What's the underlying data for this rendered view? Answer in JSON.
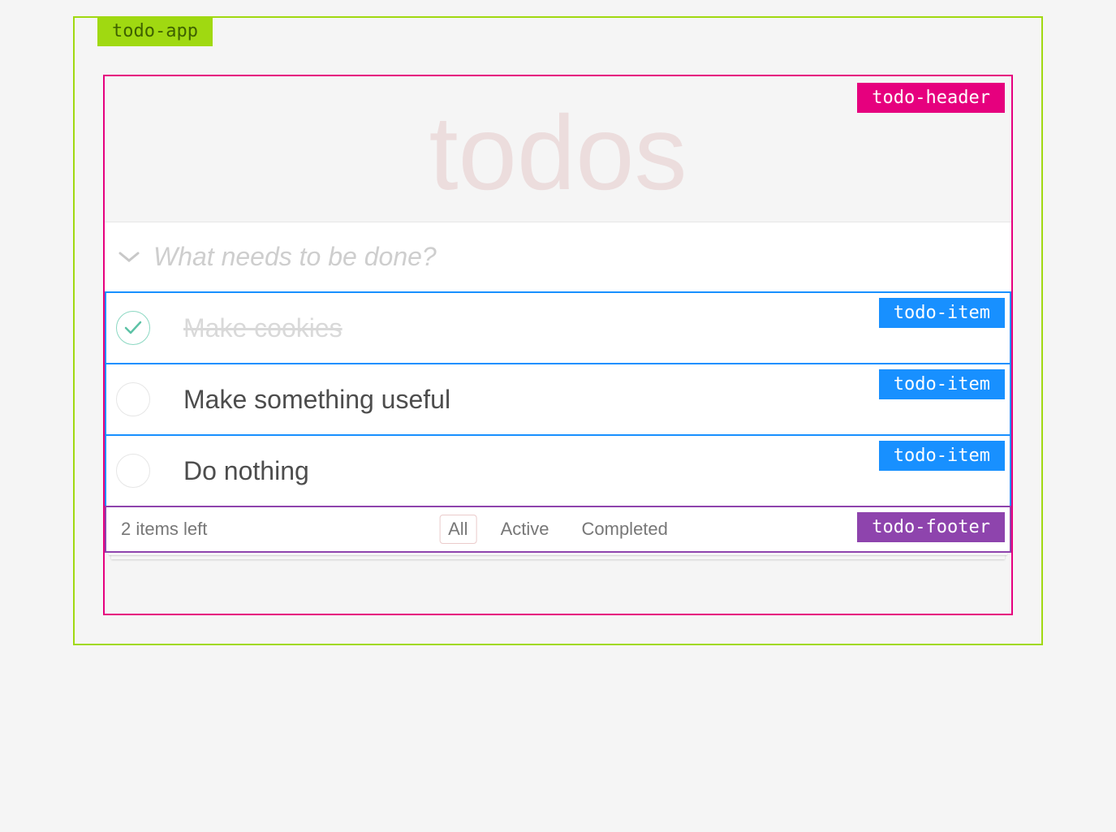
{
  "annotations": {
    "app": "todo-app",
    "header": "todo-header",
    "item": "todo-item",
    "footer": "todo-footer"
  },
  "header": {
    "title": "todos",
    "placeholder": "What needs to be done?"
  },
  "items": [
    {
      "label": "Make cookies",
      "completed": true
    },
    {
      "label": "Make something useful",
      "completed": false
    },
    {
      "label": "Do nothing",
      "completed": false
    }
  ],
  "footer": {
    "count_text": "2 items left",
    "filters": {
      "all": "All",
      "active": "Active",
      "completed": "Completed"
    },
    "selected_filter": "all"
  }
}
